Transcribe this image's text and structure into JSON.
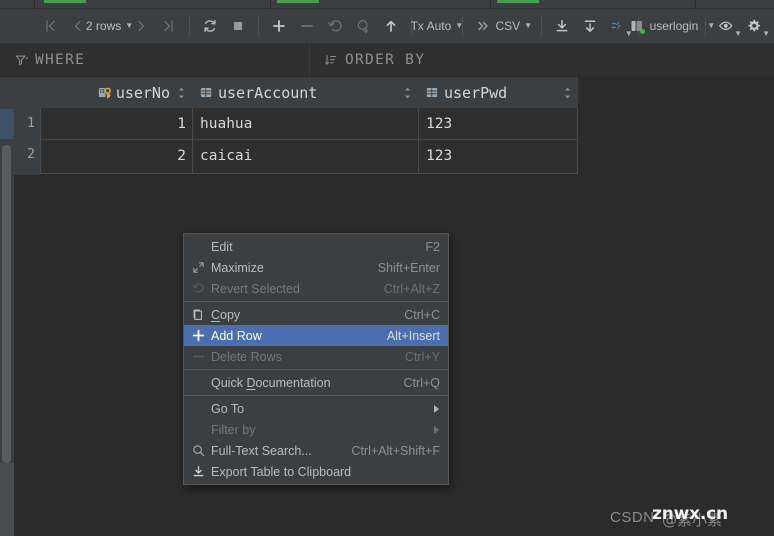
{
  "window": {
    "background_color": "#2b2b2b",
    "panel_color": "#3c3f41",
    "accent_color": "#4b6eaf",
    "tab_marker_color": "#499c54"
  },
  "toolbar": {
    "first_page_icon": "first-page-icon",
    "prev_page_icon": "previous-page-icon",
    "rows_count_label": "2 rows",
    "next_page_icon": "next-page-icon",
    "last_page_icon": "last-page-icon",
    "reload_icon": "reload-icon",
    "stop_icon": "stop-icon",
    "add_row_icon": "plus-icon",
    "delete_row_icon": "minus-icon",
    "revert_icon": "revert-icon",
    "submit_icon": "submit-icon",
    "upload_icon": "upload-icon",
    "transaction_label": "Tx Auto",
    "overflow_icon": "chevron-double-right-icon",
    "format_label": "CSV",
    "export_icon": "export-to-file-icon",
    "import_icon": "import-from-file-icon",
    "data_extractor_icon": "data-extractor-icon",
    "session_label": "userlogin",
    "session_icon": "database-session-icon",
    "view_options_icon": "eye-icon",
    "settings_icon": "gear-icon"
  },
  "filter_bar": {
    "where_icon": "filter-icon",
    "where_label": "WHERE",
    "order_icon": "sort-icon",
    "order_label": "ORDER BY"
  },
  "table": {
    "columns": [
      {
        "name": "userNo",
        "icon": "primary-key-column-icon",
        "align": "right"
      },
      {
        "name": "userAccount",
        "icon": "column-icon",
        "align": "left"
      },
      {
        "name": "userPwd",
        "icon": "column-icon",
        "align": "left"
      }
    ],
    "rows": [
      {
        "number": "1",
        "userNo": "1",
        "userAccount": "huahua",
        "userPwd": "123"
      },
      {
        "number": "2",
        "userNo": "2",
        "userAccount": "caicai",
        "userPwd": "123"
      }
    ]
  },
  "context_menu": {
    "items": [
      {
        "label": "Edit",
        "shortcut": "F2",
        "icon": null,
        "state": "normal",
        "submenu": false,
        "mnemonic": ""
      },
      {
        "label": "Maximize",
        "shortcut": "Shift+Enter",
        "icon": "maximize-icon",
        "state": "normal",
        "submenu": false,
        "mnemonic": ""
      },
      {
        "label": "Revert Selected",
        "shortcut": "Ctrl+Alt+Z",
        "icon": "revert-icon",
        "state": "disabled",
        "submenu": false,
        "mnemonic": ""
      },
      {
        "separator": true
      },
      {
        "label": "Copy",
        "shortcut": "Ctrl+C",
        "icon": "copy-icon",
        "state": "normal",
        "submenu": false,
        "mnemonic": "C"
      },
      {
        "label": "Add Row",
        "shortcut": "Alt+Insert",
        "icon": "plus-icon",
        "state": "selected",
        "submenu": false,
        "mnemonic": ""
      },
      {
        "label": "Delete Rows",
        "shortcut": "Ctrl+Y",
        "icon": "minus-icon",
        "state": "disabled",
        "submenu": false,
        "mnemonic": ""
      },
      {
        "separator": true
      },
      {
        "label": "Quick Documentation",
        "shortcut": "Ctrl+Q",
        "icon": null,
        "state": "normal",
        "submenu": false,
        "mnemonic": "D"
      },
      {
        "separator": true
      },
      {
        "label": "Go To",
        "shortcut": "",
        "icon": null,
        "state": "normal",
        "submenu": true,
        "mnemonic": ""
      },
      {
        "label": "Filter by",
        "shortcut": "",
        "icon": null,
        "state": "disabled",
        "submenu": true,
        "mnemonic": ""
      },
      {
        "label": "Full-Text Search...",
        "shortcut": "Ctrl+Alt+Shift+F",
        "icon": "search-icon",
        "state": "normal",
        "submenu": false,
        "mnemonic": ""
      },
      {
        "label": "Export Table to Clipboard",
        "shortcut": "",
        "icon": "export-icon",
        "state": "normal",
        "submenu": false,
        "mnemonic": ""
      }
    ]
  },
  "watermark": {
    "platform": "CSDN",
    "author": "@紫小素",
    "site": "znwx.cn"
  }
}
